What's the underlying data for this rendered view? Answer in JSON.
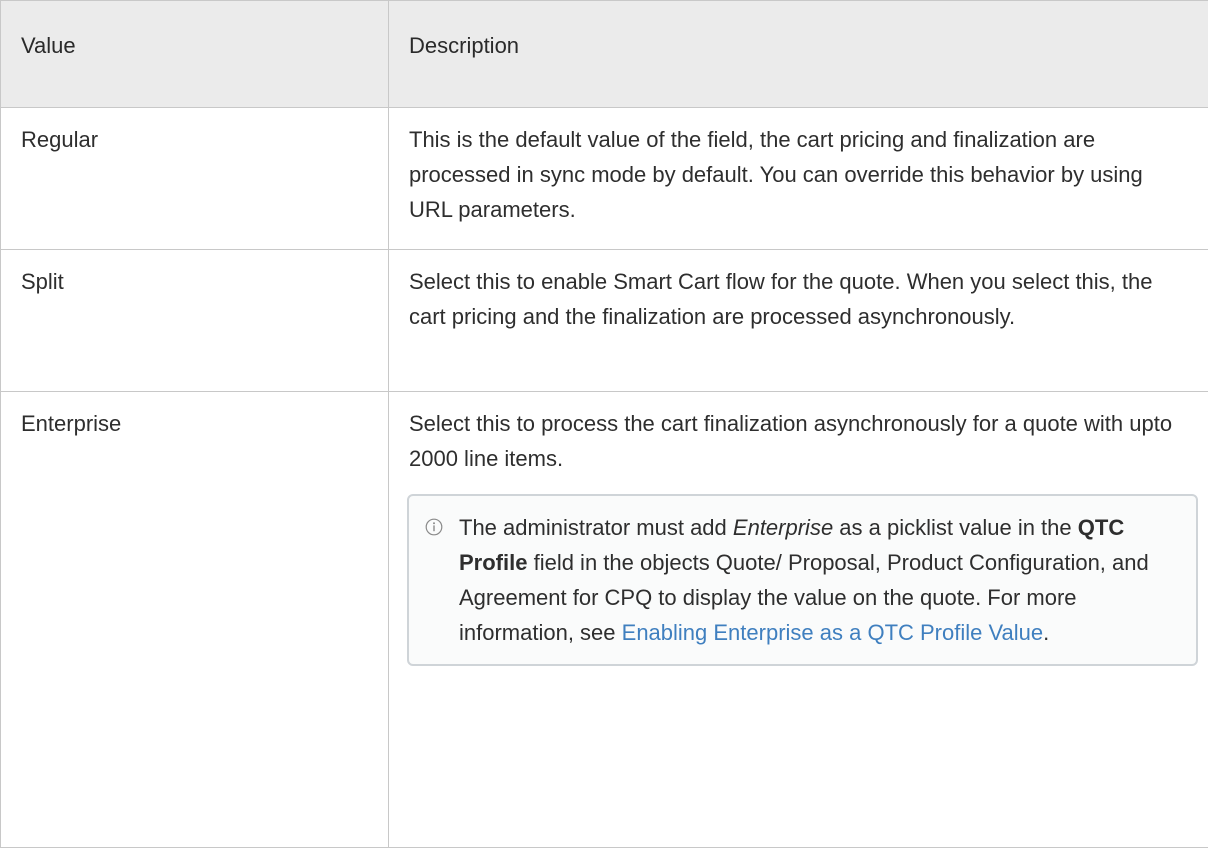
{
  "table": {
    "headers": [
      "Value",
      "Description"
    ],
    "rows": [
      {
        "value": "Regular",
        "description": "This is the default value of the field, the cart pricing and finalization are processed in sync mode by default. You can override this behavior by using URL parameters."
      },
      {
        "value": "Split",
        "description": "Select this to enable Smart Cart flow for the quote. When you select this, the cart pricing and the finalization are processed asynchronously."
      },
      {
        "value": "Enterprise",
        "description": "Select this to process the cart finalization asynchronously for a quote with upto 2000 line items."
      }
    ]
  },
  "note": {
    "icon": "info-icon",
    "part1": "The administrator must add ",
    "italic_term": "Enterprise",
    "part2": " as a picklist value in the ",
    "bold_term": "QTC Profile",
    "part3": " field in the objects Quote/ Proposal, Product Configuration, and Agreement for CPQ to display the value on the quote. For more information, see ",
    "link_text": "Enabling Enterprise as a QTC Profile Value",
    "part4": ".",
    "link_color": "#3f7fbf"
  }
}
